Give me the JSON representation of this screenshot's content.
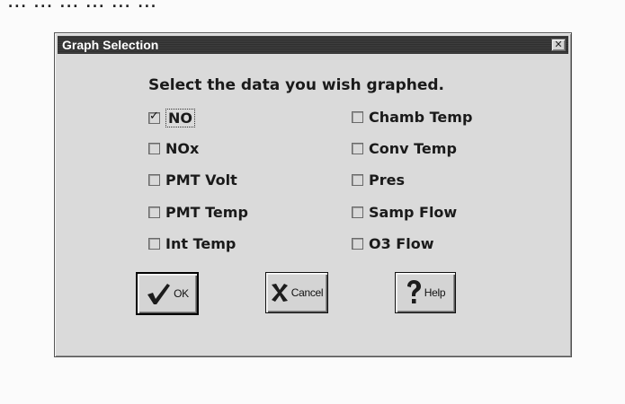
{
  "background": {
    "top_text": "... ... ... ... ... ..."
  },
  "dialog": {
    "title": "Graph Selection",
    "close_glyph": "✕",
    "prompt": "Select the data you wish graphed.",
    "options_left": [
      {
        "label": "NO",
        "checked": true
      },
      {
        "label": "NOx",
        "checked": false
      },
      {
        "label": "PMT Volt",
        "checked": false
      },
      {
        "label": "PMT Temp",
        "checked": false
      },
      {
        "label": "Int Temp",
        "checked": false
      }
    ],
    "options_right": [
      {
        "label": "Chamb Temp",
        "checked": false
      },
      {
        "label": "Conv Temp",
        "checked": false
      },
      {
        "label": "Pres",
        "checked": false
      },
      {
        "label": "Samp Flow",
        "checked": false
      },
      {
        "label": "O3 Flow",
        "checked": false
      }
    ],
    "buttons": {
      "ok": {
        "label": "OK",
        "icon": "checkmark-icon"
      },
      "cancel": {
        "label": "Cancel",
        "icon": "x-icon"
      },
      "help": {
        "label": "Help",
        "icon": "question-mark-icon"
      }
    }
  }
}
